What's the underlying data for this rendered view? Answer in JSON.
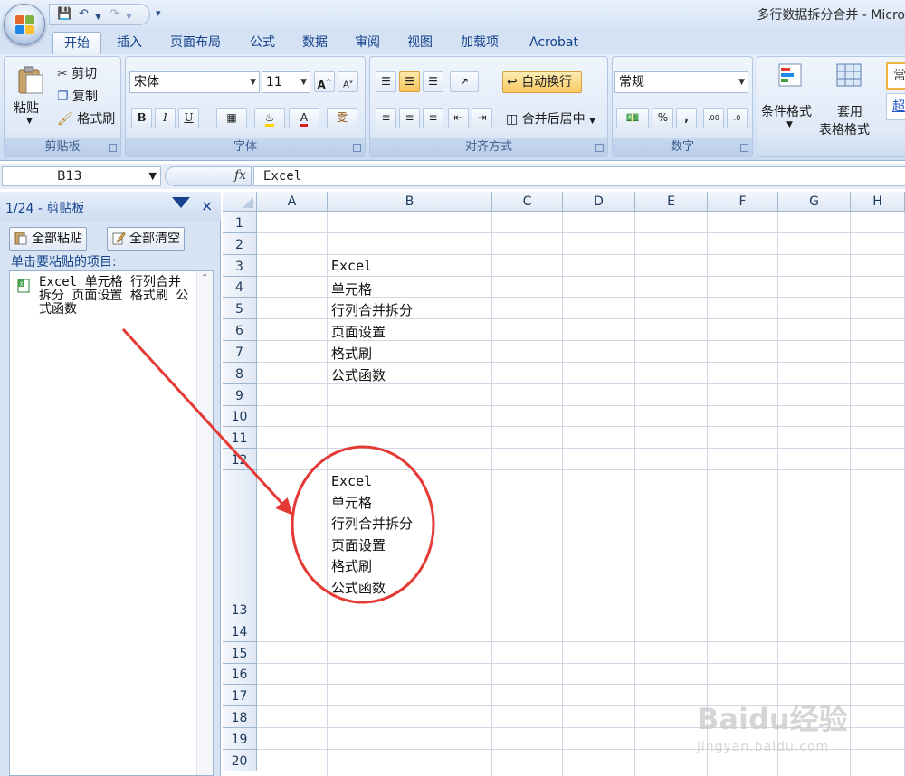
{
  "window": {
    "title": "多行数据拆分合并 - Micro"
  },
  "tabs": [
    "开始",
    "插入",
    "页面布局",
    "公式",
    "数据",
    "审阅",
    "视图",
    "加载项",
    "Acrobat"
  ],
  "ribbon": {
    "clipboard": {
      "paste": "粘贴",
      "cut": "剪切",
      "copy": "复制",
      "format_painter": "格式刷",
      "label": "剪贴板"
    },
    "font": {
      "name": "宋体",
      "size": "11",
      "label": "字体",
      "bold": "B",
      "italic": "I",
      "underline": "U",
      "grow": "A",
      "shrink": "A",
      "phonetic": "雯"
    },
    "alignment": {
      "wrap_text": "自动换行",
      "merge_center": "合并后居中",
      "label": "对齐方式"
    },
    "number": {
      "format": "常规",
      "percent": "%",
      "comma": ",",
      "label": "数字"
    },
    "styles": {
      "conditional": "条件格式",
      "table_format_1": "套用",
      "table_format_2": "表格格式",
      "cell_style": "常",
      "hyperlink": "超"
    }
  },
  "formula_bar": {
    "name_box": "B13",
    "fx": "fx",
    "value": "Excel"
  },
  "clipboard_pane": {
    "title": "1/24 - 剪贴板",
    "paste_all": "全部粘贴",
    "clear_all": "全部清空",
    "hint": "单击要粘贴的项目:",
    "item": "Excel 单元格 行列合并拆分 页面设置 格式刷 公式函数"
  },
  "sheet": {
    "columns": [
      "A",
      "B",
      "C",
      "D",
      "E",
      "F",
      "G",
      "H"
    ],
    "rows": [
      "1",
      "2",
      "3",
      "4",
      "5",
      "6",
      "7",
      "8",
      "9",
      "10",
      "11",
      "12",
      "13",
      "14",
      "15",
      "16",
      "17",
      "18",
      "19",
      "20"
    ],
    "b_values": [
      "Excel",
      "单元格",
      "行列合并拆分",
      "页面设置",
      "格式刷",
      "公式函数"
    ],
    "b13": "Excel\n单元格\n行列合并拆分\n页面设置\n格式刷\n公式函数"
  },
  "watermark": {
    "brand": "Baidu经验",
    "url": "jingyan.baidu.com"
  },
  "colors": {
    "ribbon_blue": "#dbe7f6",
    "tab_text": "#15428b",
    "annotation_red": "#e53935",
    "highlight": "#f8c760"
  }
}
